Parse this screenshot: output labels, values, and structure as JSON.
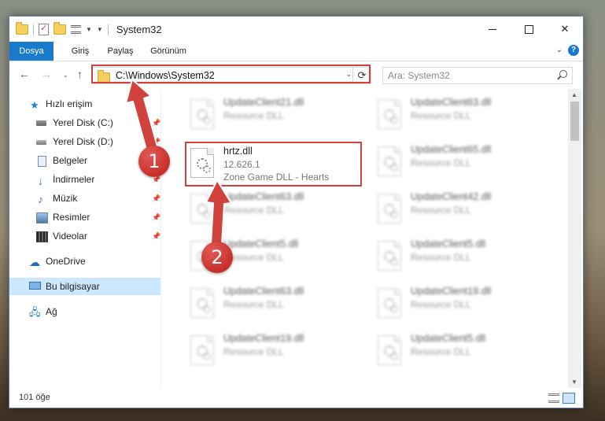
{
  "window": {
    "title": "System32",
    "minimize": "—",
    "close": "✕"
  },
  "ribbon": {
    "tabs": [
      "Dosya",
      "Giriş",
      "Paylaş",
      "Görünüm"
    ],
    "help": "?"
  },
  "nav": {
    "back": "←",
    "forward": "→",
    "history": "⌄",
    "up": "↑",
    "address": "C:\\Windows\\System32",
    "refresh": "⟳",
    "search_placeholder": "Ara: System32"
  },
  "sidebar": {
    "items": [
      {
        "label": "Hızlı erişim",
        "icon": "star-icon"
      },
      {
        "label": "Yerel Disk (C:)",
        "icon": "drive-icon",
        "pinned": true
      },
      {
        "label": "Yerel Disk (D:)",
        "icon": "drive-icon",
        "pinned": true
      },
      {
        "label": "Belgeler",
        "icon": "documents-icon",
        "pinned": true
      },
      {
        "label": "İndirmeler",
        "icon": "download-icon",
        "pinned": true
      },
      {
        "label": "Müzik",
        "icon": "music-icon",
        "pinned": true
      },
      {
        "label": "Resimler",
        "icon": "pictures-icon",
        "pinned": true
      },
      {
        "label": "Videolar",
        "icon": "videos-icon",
        "pinned": true
      },
      {
        "label": "OneDrive",
        "icon": "onedrive-icon"
      },
      {
        "label": "Bu bilgisayar",
        "icon": "computer-icon",
        "selected": true
      },
      {
        "label": "Ağ",
        "icon": "network-icon"
      }
    ]
  },
  "files": {
    "col1": [
      {
        "name": "UpdateClient21.dll",
        "desc": "Resource DLL"
      },
      {
        "name": "hrtz.dll",
        "version": "12.626.1",
        "desc": "Zone Game DLL - Hearts",
        "highlighted": true
      },
      {
        "name": "UpdateClient63.dll",
        "desc": "Resource DLL"
      },
      {
        "name": "UpdateClient5.dll",
        "desc": "Resource DLL"
      },
      {
        "name": "UpdateClient63.dll",
        "desc": "Resource DLL"
      },
      {
        "name": "UpdateClient19.dll",
        "desc": "Resource DLL"
      }
    ],
    "col2": [
      {
        "name": "UpdateClient63.dll",
        "desc": "Resource DLL"
      },
      {
        "name": "UpdateClient65.dll",
        "desc": "Resource DLL"
      },
      {
        "name": "UpdateClient42.dll",
        "desc": "Resource DLL"
      },
      {
        "name": "UpdateClient5.dll",
        "desc": "Resource DLL"
      },
      {
        "name": "UpdateClient19.dll",
        "desc": "Resource DLL"
      },
      {
        "name": "UpdateClient5.dll",
        "desc": "Resource DLL"
      }
    ]
  },
  "status": {
    "count": "101 öğe"
  },
  "annotations": {
    "step1": "1",
    "step2": "2",
    "color": "#d2423c"
  }
}
